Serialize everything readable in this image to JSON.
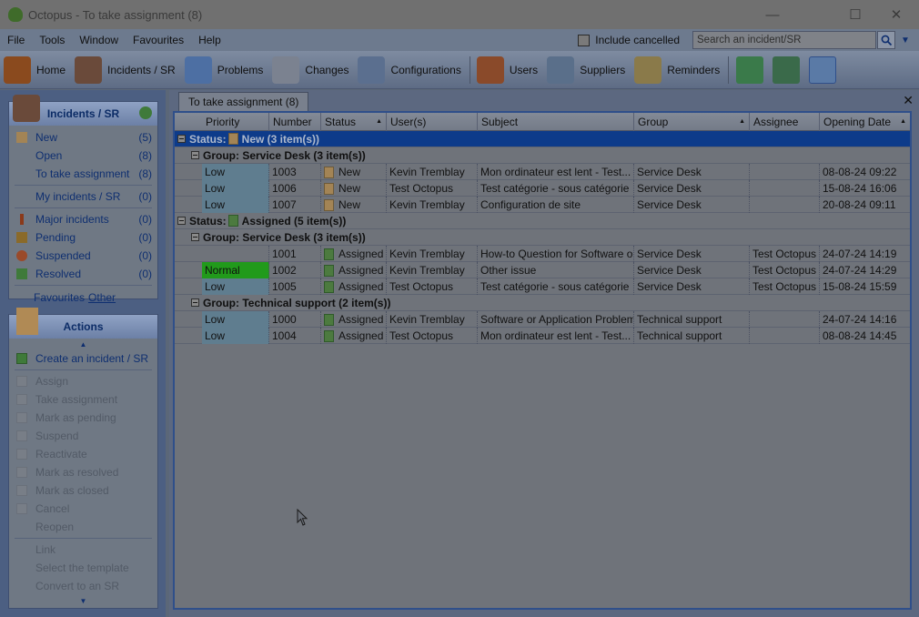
{
  "window": {
    "title": "Octopus - To take assignment (8)",
    "minimize": "—",
    "maximize": "☐",
    "close": "✕"
  },
  "menu": {
    "items": [
      "File",
      "Tools",
      "Window",
      "Favourites",
      "Help"
    ],
    "include_cancelled": "Include cancelled",
    "search_placeholder": "Search an incident/SR"
  },
  "toolbar": {
    "buttons": [
      {
        "label": "Home",
        "icon": "home-icon",
        "color": "#8a4a1e"
      },
      {
        "label": "Incidents / SR",
        "icon": "incidents-icon",
        "color": "#6a4a3a"
      },
      {
        "label": "Problems",
        "icon": "problems-icon",
        "color": "#4d6fa3"
      },
      {
        "label": "Changes",
        "icon": "changes-icon",
        "color": "#7b8290"
      },
      {
        "label": "Configurations",
        "icon": "configurations-icon",
        "color": "#5b6f8f"
      },
      {
        "label": "Users",
        "icon": "users-icon",
        "color": "#8a4a2a"
      },
      {
        "label": "Suppliers",
        "icon": "suppliers-icon",
        "color": "#5a6f8a"
      },
      {
        "label": "Reminders",
        "icon": "reminders-icon",
        "color": "#8a7a4a"
      }
    ]
  },
  "left_panel": {
    "incidents_header": "Incidents / SR",
    "items": [
      {
        "label": "New",
        "count": "(5)"
      },
      {
        "label": "Open",
        "count": "(8)"
      },
      {
        "label": "To take assignment",
        "count": "(8)"
      },
      {
        "label": "My incidents / SR",
        "count": "(0)"
      },
      {
        "label": "Major incidents",
        "count": "(0)"
      },
      {
        "label": "Pending",
        "count": "(0)"
      },
      {
        "label": "Suspended",
        "count": "(0)"
      },
      {
        "label": "Resolved",
        "count": "(0)"
      }
    ],
    "favourites": "Favourites",
    "other": "Other",
    "actions_header": "Actions",
    "actions": [
      "Create an incident / SR",
      "Assign",
      "Take assignment",
      "Mark as pending",
      "Suspend",
      "Reactivate",
      "Mark as resolved",
      "Mark as closed",
      "Cancel",
      "Reopen",
      "Link",
      "Select the template",
      "Convert to an SR"
    ]
  },
  "main": {
    "tab_label": "To take assignment (8)",
    "columns": [
      "Priority",
      "Number",
      "Status",
      "User(s)",
      "Subject",
      "Group",
      "Assignee",
      "Opening Date"
    ],
    "status_new": {
      "prefix": "Status:",
      "label": "New (3 item(s))"
    },
    "group_sd_new": "Group: Service Desk (3 item(s))",
    "rows_new": [
      {
        "priority": "Low",
        "number": "1003",
        "status": "New",
        "user": "Kevin Tremblay",
        "subject": "Mon ordinateur est lent - Test...",
        "group": "Service Desk",
        "assignee": "",
        "date": "08-08-24 09:22"
      },
      {
        "priority": "Low",
        "number": "1006",
        "status": "New",
        "user": "Test Octopus",
        "subject": "Test catégorie - sous catégorie",
        "group": "Service Desk",
        "assignee": "",
        "date": "15-08-24 16:06"
      },
      {
        "priority": "Low",
        "number": "1007",
        "status": "New",
        "user": "Kevin Tremblay",
        "subject": "Configuration de site",
        "group": "Service Desk",
        "assignee": "",
        "date": "20-08-24 09:11"
      }
    ],
    "status_assigned": {
      "prefix": "Status:",
      "label": "Assigned (5 item(s))"
    },
    "group_sd_assigned": "Group: Service Desk (3 item(s))",
    "rows_assigned_sd": [
      {
        "priority": "",
        "number": "1001",
        "status": "Assigned",
        "user": "Kevin Tremblay",
        "subject": "How-to Question for Software o...",
        "group": "Service Desk",
        "assignee": "Test Octopus",
        "date": "24-07-24 14:19"
      },
      {
        "priority": "Normal",
        "number": "1002",
        "status": "Assigned",
        "user": "Kevin Tremblay",
        "subject": "Other issue",
        "group": "Service Desk",
        "assignee": "Test Octopus",
        "date": "24-07-24 14:29"
      },
      {
        "priority": "Low",
        "number": "1005",
        "status": "Assigned",
        "user": "Test Octopus",
        "subject": "Test catégorie - sous catégorie",
        "group": "Service Desk",
        "assignee": "Test Octopus",
        "date": "15-08-24 15:59"
      }
    ],
    "group_ts": "Group: Technical support (2 item(s))",
    "rows_ts": [
      {
        "priority": "Low",
        "number": "1000",
        "status": "Assigned",
        "user": "Kevin Tremblay",
        "subject": "Software or Application Problem",
        "group": "Technical support",
        "assignee": "",
        "date": "24-07-24 14:16"
      },
      {
        "priority": "Low",
        "number": "1004",
        "status": "Assigned",
        "user": "Test Octopus",
        "subject": "Mon ordinateur est lent - Test...",
        "group": "Technical support",
        "assignee": "",
        "date": "08-08-24 14:45"
      }
    ]
  }
}
